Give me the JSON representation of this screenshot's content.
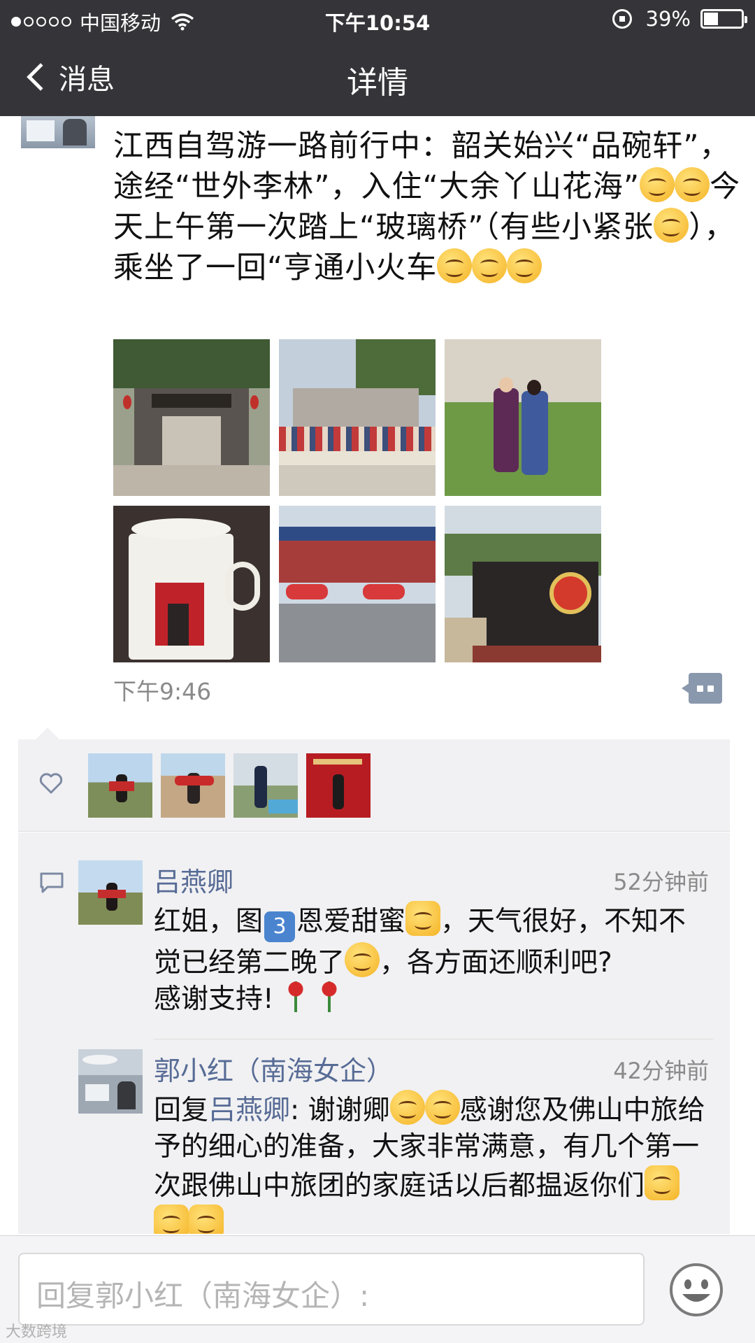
{
  "status_bar": {
    "carrier": "中国移动",
    "time": "下午10:54",
    "battery": "39%",
    "battery_level": 0.39
  },
  "nav": {
    "back_label": "消息",
    "title": "详情"
  },
  "post": {
    "text_parts": [
      "江西自驾游一路前行中：韶关始兴“品碗轩”，途经“世外李林”，入住“大余丫山花海”",
      "今天上午第一次踏上“玻璃桥”（有些小紧张",
      "），乘坐了一回“亨通小火车"
    ],
    "emoji": [
      "smile-emoji",
      "smile-emoji",
      "tongue-emoji",
      "grin-emoji",
      "grin-emoji",
      "grin-emoji"
    ],
    "time": "下午9:46",
    "photos": [
      {
        "icon": "photo-gate"
      },
      {
        "icon": "photo-group"
      },
      {
        "icon": "photo-couple"
      },
      {
        "icon": "photo-mug"
      },
      {
        "icon": "photo-station"
      },
      {
        "icon": "photo-train"
      }
    ]
  },
  "likes": {
    "count": 4
  },
  "comments": [
    {
      "name": "吕燕卿",
      "time": "52分钟前",
      "text_parts": [
        "红姐，图",
        "恩爱甜蜜",
        "，天气很好，不知不觉已经第二晚了",
        "，各方面还顺利吧?\n感谢支持!"
      ],
      "badge": "3"
    },
    {
      "name": "郭小红（南海女企）",
      "time": "42分钟前",
      "reply_prefix": "回复",
      "reply_to": "吕燕卿",
      "text_parts": [
        ": 谢谢卿",
        "感谢您及佛山中旅给予的细心的准备，大家非常满意，有几个第一次跟佛山中旅团的家庭话以后都揾返你们"
      ]
    }
  ],
  "input": {
    "placeholder": "回复郭小红（南海女企）:"
  },
  "watermark": "大数跨境",
  "colors": {
    "nav_bg": "#353539",
    "name_link": "#576b95",
    "panel_bg": "#f1f1f3"
  }
}
